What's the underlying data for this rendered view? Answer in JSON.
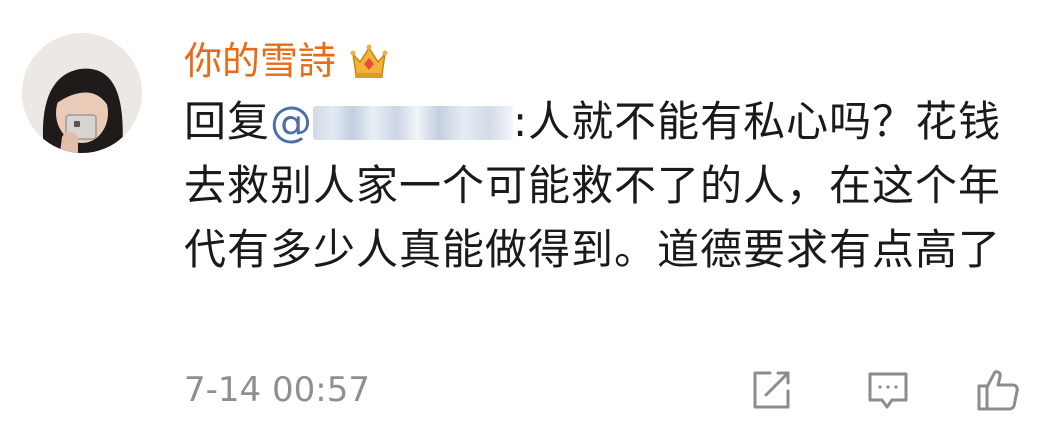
{
  "comment": {
    "username": "你的雪詩",
    "badge_icon": "crown-icon",
    "reply_prefix": "回复",
    "mention": "@",
    "content_after_mention": ":人就不能有私心吗？花钱去救别人家一个可能救不了的人，在这个年代有多少人真能做得到。道德要求有点高了",
    "timestamp": "7-14 00:57"
  },
  "actions": [
    {
      "name": "edit-icon"
    },
    {
      "name": "comment-icon"
    },
    {
      "name": "like-icon"
    }
  ],
  "colors": {
    "username": "#e86b17",
    "mention": "#4e6ea8",
    "text": "#1a1a1a",
    "muted": "#8f8f8f"
  }
}
